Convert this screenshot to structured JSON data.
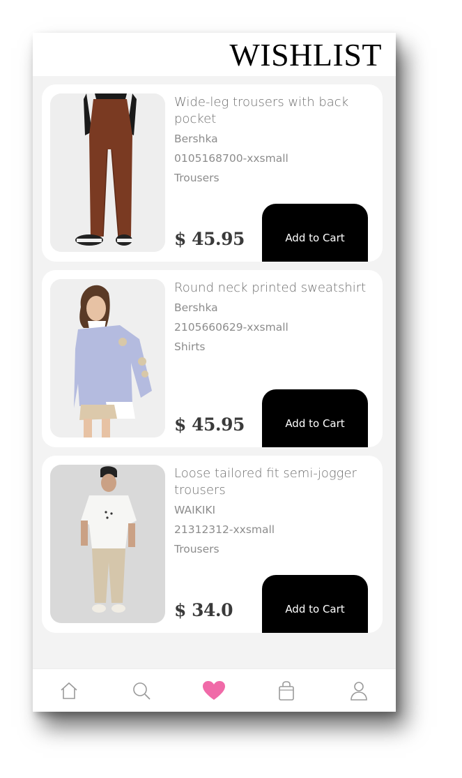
{
  "header": {
    "title": "WISHLIST"
  },
  "items": [
    {
      "name": "Wide-leg trousers with back pocket",
      "brand": "Bershka",
      "sku": "0105168700-xxsmall",
      "category": "Trousers",
      "price": "$ 45.95",
      "button_label": "Add to Cart"
    },
    {
      "name": "Round neck printed sweatshirt",
      "brand": "Bershka",
      "sku": "2105660629-xxsmall",
      "category": "Shirts",
      "price": "$ 45.95",
      "button_label": "Add to Cart"
    },
    {
      "name": "Loose tailored fit semi-jogger trousers",
      "brand": "WAIKIKI",
      "sku": "21312312-xxsmall",
      "category": "Trousers",
      "price": "$ 34.0",
      "button_label": "Add to Cart"
    }
  ],
  "tabbar": {
    "tabs": [
      "home-icon",
      "search-icon",
      "heart-icon",
      "shopping-bag-icon",
      "profile-icon"
    ],
    "active": "heart-icon",
    "active_color": "#f06aa8",
    "inactive_color": "#9a9a9a"
  }
}
